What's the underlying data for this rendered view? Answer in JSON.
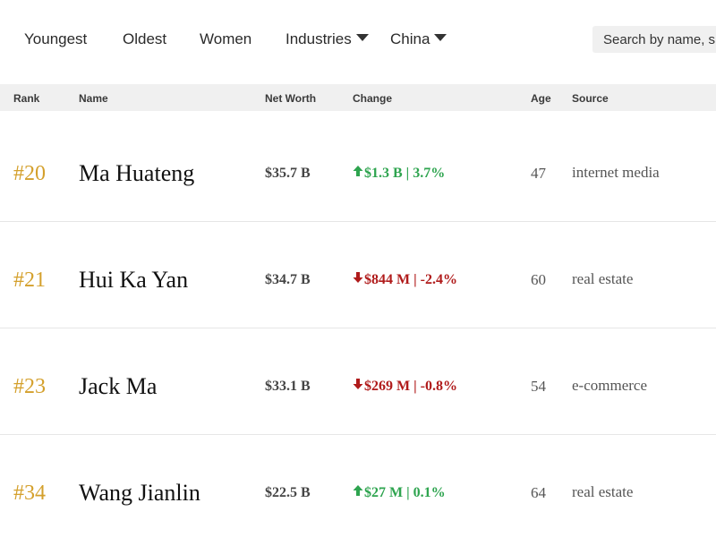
{
  "filters": {
    "youngest": "Youngest",
    "oldest": "Oldest",
    "women": "Women",
    "industries": "Industries",
    "country": "China"
  },
  "search": {
    "placeholder": "Search by name, s"
  },
  "columns": {
    "rank": "Rank",
    "name": "Name",
    "net_worth": "Net Worth",
    "change": "Change",
    "age": "Age",
    "source": "Source"
  },
  "colors": {
    "rank_gold": "#d4a02c",
    "change_up": "#2ea44f",
    "change_down": "#b01b1b",
    "header_bg": "#f0f0f0"
  },
  "icons": {
    "filter_dropdown": "caret-down-icon",
    "change_up": "arrow-up-icon",
    "change_down": "arrow-down-icon"
  },
  "rows": [
    {
      "rank": "#20",
      "name": "Ma Huateng",
      "net_worth": "$35.7 B",
      "direction": "up",
      "change": "$1.3 B | 3.7%",
      "age": "47",
      "source": "internet media"
    },
    {
      "rank": "#21",
      "name": "Hui Ka Yan",
      "net_worth": "$34.7 B",
      "direction": "down",
      "change": "$844 M | -2.4%",
      "age": "60",
      "source": "real estate"
    },
    {
      "rank": "#23",
      "name": "Jack Ma",
      "net_worth": "$33.1 B",
      "direction": "down",
      "change": "$269 M | -0.8%",
      "age": "54",
      "source": "e-commerce"
    },
    {
      "rank": "#34",
      "name": "Wang Jianlin",
      "net_worth": "$22.5 B",
      "direction": "up",
      "change": "$27 M | 0.1%",
      "age": "64",
      "source": "real estate"
    }
  ]
}
